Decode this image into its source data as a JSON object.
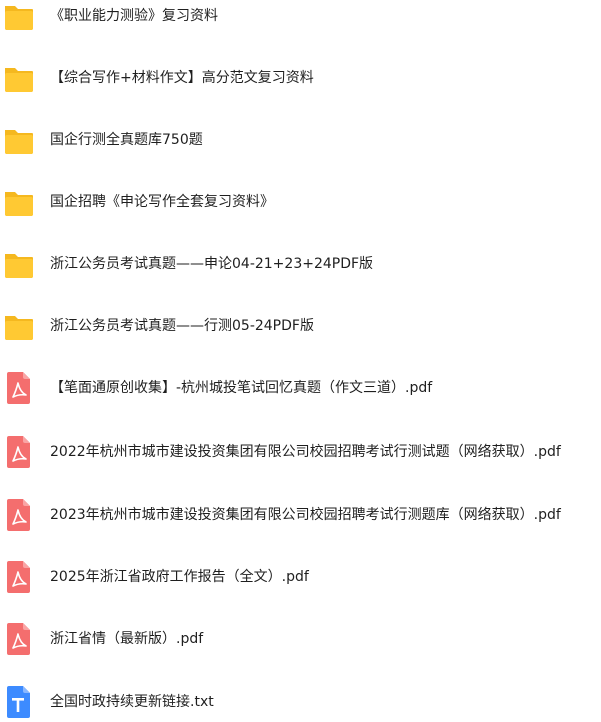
{
  "files": [
    {
      "name": "《职业能力测验》复习资料",
      "icon": "folder-icon",
      "type": "folder"
    },
    {
      "name": "【综合写作+材料作文】高分范文复习资料",
      "icon": "folder-icon",
      "type": "folder"
    },
    {
      "name": "国企行测全真题库750题",
      "icon": "folder-icon",
      "type": "folder"
    },
    {
      "name": "国企招聘《申论写作全套复习资料》",
      "icon": "folder-icon",
      "type": "folder"
    },
    {
      "name": "浙江公务员考试真题——申论04-21+23+24PDF版",
      "icon": "folder-icon",
      "type": "folder"
    },
    {
      "name": "浙江公务员考试真题——行测05-24PDF版",
      "icon": "folder-icon",
      "type": "folder"
    },
    {
      "name": "【笔面通原创收集】-杭州城投笔试回忆真题（作文三道）.pdf",
      "icon": "pdf-file-icon",
      "type": "pdf"
    },
    {
      "name": "2022年杭州市城市建设投资集团有限公司校园招聘考试行测试题（网络获取）.pdf",
      "icon": "pdf-file-icon",
      "type": "pdf"
    },
    {
      "name": "2023年杭州市城市建设投资集团有限公司校园招聘考试行测题库（网络获取）.pdf",
      "icon": "pdf-file-icon",
      "type": "pdf"
    },
    {
      "name": "2025年浙江省政府工作报告（全文）.pdf",
      "icon": "pdf-file-icon",
      "type": "pdf"
    },
    {
      "name": "浙江省情（最新版）.pdf",
      "icon": "pdf-file-icon",
      "type": "pdf"
    },
    {
      "name": "全国时政持续更新链接.txt",
      "icon": "text-file-icon",
      "type": "txt"
    }
  ],
  "colors": {
    "folder": "#FFC933",
    "folder_tab": "#F5B81F",
    "pdf": "#F46E6E",
    "txt": "#3D8BFF",
    "text": "#1f1f1f"
  }
}
